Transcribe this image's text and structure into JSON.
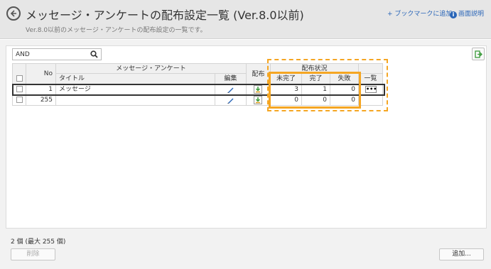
{
  "header": {
    "title": "メッセージ・アンケートの配布設定一覧 (Ver.8.0以前)",
    "subtitle": "Ver.8.0以前のメッセージ・アンケートの配布設定の一覧です。",
    "bookmark_label": "+ ブックマークに追加",
    "help_label": "画面説明"
  },
  "search": {
    "value": "AND",
    "placeholder": ""
  },
  "table": {
    "group_header": "メッセージ・アンケート",
    "status_group_header": "配布状況",
    "col_no": "No",
    "col_title": "タイトル",
    "col_edit": "編集",
    "col_distribute": "配布",
    "col_incomplete": "未完了",
    "col_complete": "完了",
    "col_failed": "失敗",
    "col_list": "一覧",
    "rows": [
      {
        "no": "1",
        "title": "メッセージ",
        "incomplete": "3",
        "complete": "1",
        "failed": "0",
        "list_label": "•••"
      },
      {
        "no": "255",
        "title": "",
        "incomplete": "0",
        "complete": "0",
        "failed": "0",
        "list_label": ""
      }
    ]
  },
  "footer": {
    "count_text": "2 個 (最大 255 個)",
    "delete_label": "削除",
    "add_label": "追加..."
  },
  "colors": {
    "accent": "#f5a623",
    "link": "#2a66b8",
    "header_bg": "#e6e6e6"
  }
}
